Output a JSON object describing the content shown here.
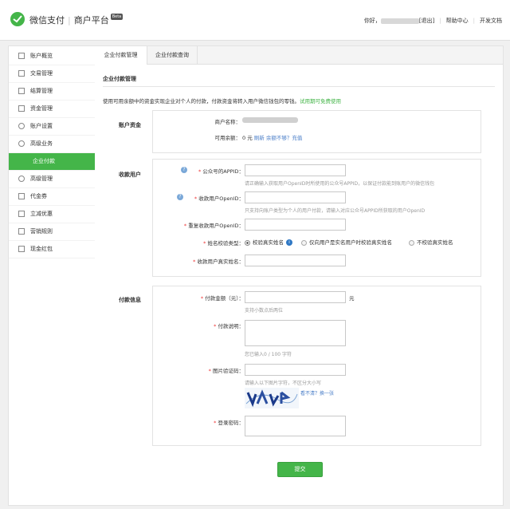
{
  "header": {
    "brand_name": "微信支付",
    "brand_product": "商户平台",
    "beta_badge": "Beta",
    "greeting": "你好，",
    "logout": "[退出]",
    "help_center": "帮助中心",
    "dev_docs": "开发文档"
  },
  "sidebar": {
    "items": [
      {
        "label": "账户概览",
        "icon": "grid-icon"
      },
      {
        "label": "交易管理",
        "icon": "list-icon"
      },
      {
        "label": "结算管理",
        "icon": "doc-icon"
      },
      {
        "label": "资金管理",
        "icon": "money-icon"
      },
      {
        "label": "账户设置",
        "icon": "gear-icon"
      },
      {
        "label": "高级业务",
        "icon": "star-icon"
      },
      {
        "label": "企业付款",
        "icon": "",
        "active": true
      },
      {
        "label": "高级管理",
        "icon": "shield-icon"
      },
      {
        "label": "代金券",
        "icon": "ticket-icon"
      },
      {
        "label": "立减优惠",
        "icon": "discount-icon"
      },
      {
        "label": "营销规则",
        "icon": "rule-icon"
      },
      {
        "label": "现金红包",
        "icon": "envelope-icon"
      }
    ]
  },
  "tabs": [
    {
      "label": "企业付款管理",
      "active": true
    },
    {
      "label": "企业付款查询",
      "active": false
    }
  ],
  "main": {
    "section_title": "企业付款管理",
    "intro": "使用可用余额中的资金实现企业对个人的付款，付款资金将转入用户微信钱包的零钱。",
    "intro_link": "试用期可免费使用"
  },
  "account": {
    "block_label": "账户资金",
    "merchant_name_label": "商户名称：",
    "balance_label": "可用余额：",
    "balance_value": "0 元",
    "refresh_link": "刷新",
    "insufficient_link": "余额不够？充值"
  },
  "payee": {
    "block_label": "收款用户",
    "appid_label": "公众号的APPID：",
    "appid_hint": "请正确输入获取用户OpenID时所使用的公众号APPID，以保证付款能到账用户的微信钱包",
    "openid_label": "收款用户OpenID：",
    "openid_hint": "只支持向账户类型为个人的用户付款，请输入对应公众号APPID所获取的用户OpenID",
    "openid_repeat_label": "重复收款用户OpenID：",
    "name_check_label": "姓名校验类型：",
    "radio_options": [
      {
        "label": "校验真实姓名",
        "checked": true
      },
      {
        "label": "仅向用户是实名用户时校验真实姓名",
        "checked": false
      },
      {
        "label": "不校验真实姓名",
        "checked": false
      }
    ],
    "real_name_label": "收款用户真实姓名："
  },
  "payment": {
    "block_label": "付款信息",
    "amount_label": "付款金额（元）：",
    "amount_unit": "元",
    "amount_hint": "支持小数点后两位",
    "desc_label": "付款说明：",
    "desc_hint": "您已输入0 / 100 字符",
    "captcha_label": "图片验证码：",
    "captcha_hint": "请输入以下图片字符，不区分大小写",
    "captcha_refresh": "看不清？换一张",
    "password_label": "登录密码："
  },
  "submit_label": "提交",
  "colors": {
    "accent": "#44b549",
    "link": "#4a7ec8",
    "required": "#e33333"
  }
}
